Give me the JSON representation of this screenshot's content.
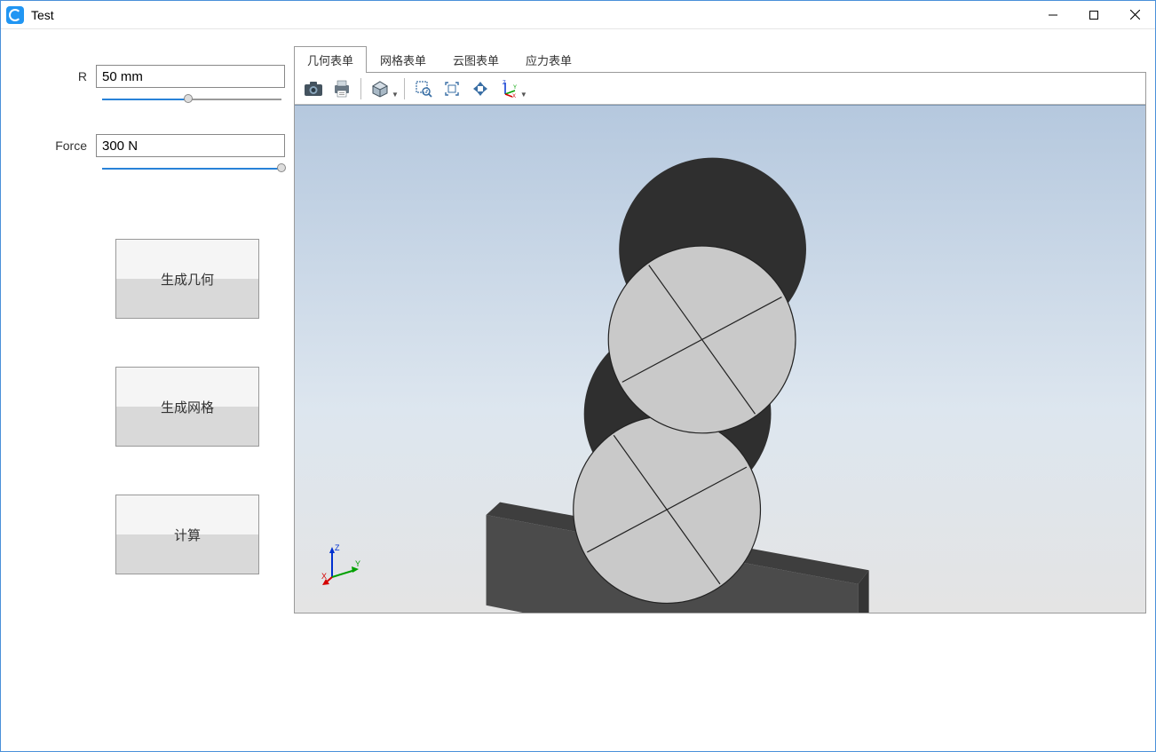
{
  "window": {
    "title": "Test"
  },
  "params": {
    "r_label": "R",
    "r_value": "50 mm",
    "r_slider_percent": 48,
    "force_label": "Force",
    "force_value": "300 N",
    "force_slider_percent": 98
  },
  "buttons": {
    "generate_geometry": "生成几何",
    "generate_mesh": "生成网格",
    "compute": "计算"
  },
  "tabs": [
    {
      "label": "几何表单",
      "active": true
    },
    {
      "label": "网格表单",
      "active": false
    },
    {
      "label": "云图表单",
      "active": false
    },
    {
      "label": "应力表单",
      "active": false
    }
  ],
  "toolbar": {
    "icons": [
      "camera",
      "print",
      "shade-mode",
      "zoom-box",
      "fit",
      "rotate-view",
      "axes"
    ]
  },
  "triad": {
    "axes": [
      "X",
      "Y",
      "Z"
    ],
    "colors": {
      "x": "#d40000",
      "y": "#00a000",
      "z": "#0030d0"
    }
  }
}
